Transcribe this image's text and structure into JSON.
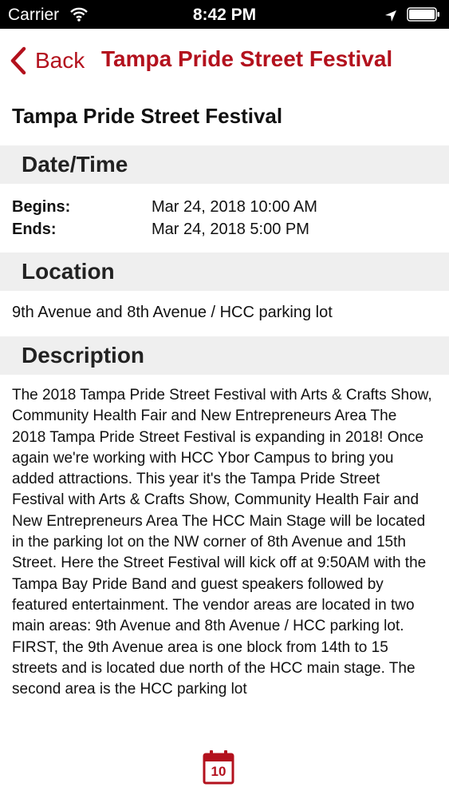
{
  "status_bar": {
    "carrier": "Carrier",
    "time": "8:42 PM"
  },
  "nav": {
    "back_label": "Back",
    "title": "Tampa Pride Street Festival"
  },
  "event": {
    "title": "Tampa Pride Street Festival"
  },
  "date_time": {
    "header": "Date/Time",
    "begins_label": "Begins:",
    "begins_value": "Mar 24, 2018 10:00 AM",
    "ends_label": "Ends:",
    "ends_value": "Mar 24, 2018 5:00 PM"
  },
  "location": {
    "header": "Location",
    "text": "9th Avenue and 8th Avenue / HCC parking lot"
  },
  "description": {
    "header": "Description",
    "text": "The 2018 Tampa Pride Street Festival with Arts & Crafts Show, Community Health Fair and New Entrepreneurs Area The 2018 Tampa Pride Street Festival is expanding in 2018! Once again we're working with HCC Ybor Campus to bring you added attractions. This year it's the Tampa Pride Street Festival with Arts & Crafts Show, Community Health Fair and New Entrepreneurs Area The HCC Main Stage will be located in the parking lot on the NW corner of 8th Avenue and 15th Street. Here the Street Festival will kick off at 9:50AM with the Tampa Bay Pride Band and guest speakers followed by featured entertainment. The vendor areas are located in two main areas: 9th Avenue and 8th Avenue / HCC parking lot. FIRST, the 9th Avenue area is one block from 14th to 15 streets and is located due north of the HCC main stage. The second area is the HCC parking lot"
  },
  "tab_bar": {
    "calendar_day": "10"
  },
  "colors": {
    "accent": "#b3111d",
    "section_bg": "#efefef"
  },
  "icons": [
    "wifi-icon",
    "location-arrow-icon",
    "battery-icon",
    "chevron-left-icon",
    "calendar-icon"
  ]
}
